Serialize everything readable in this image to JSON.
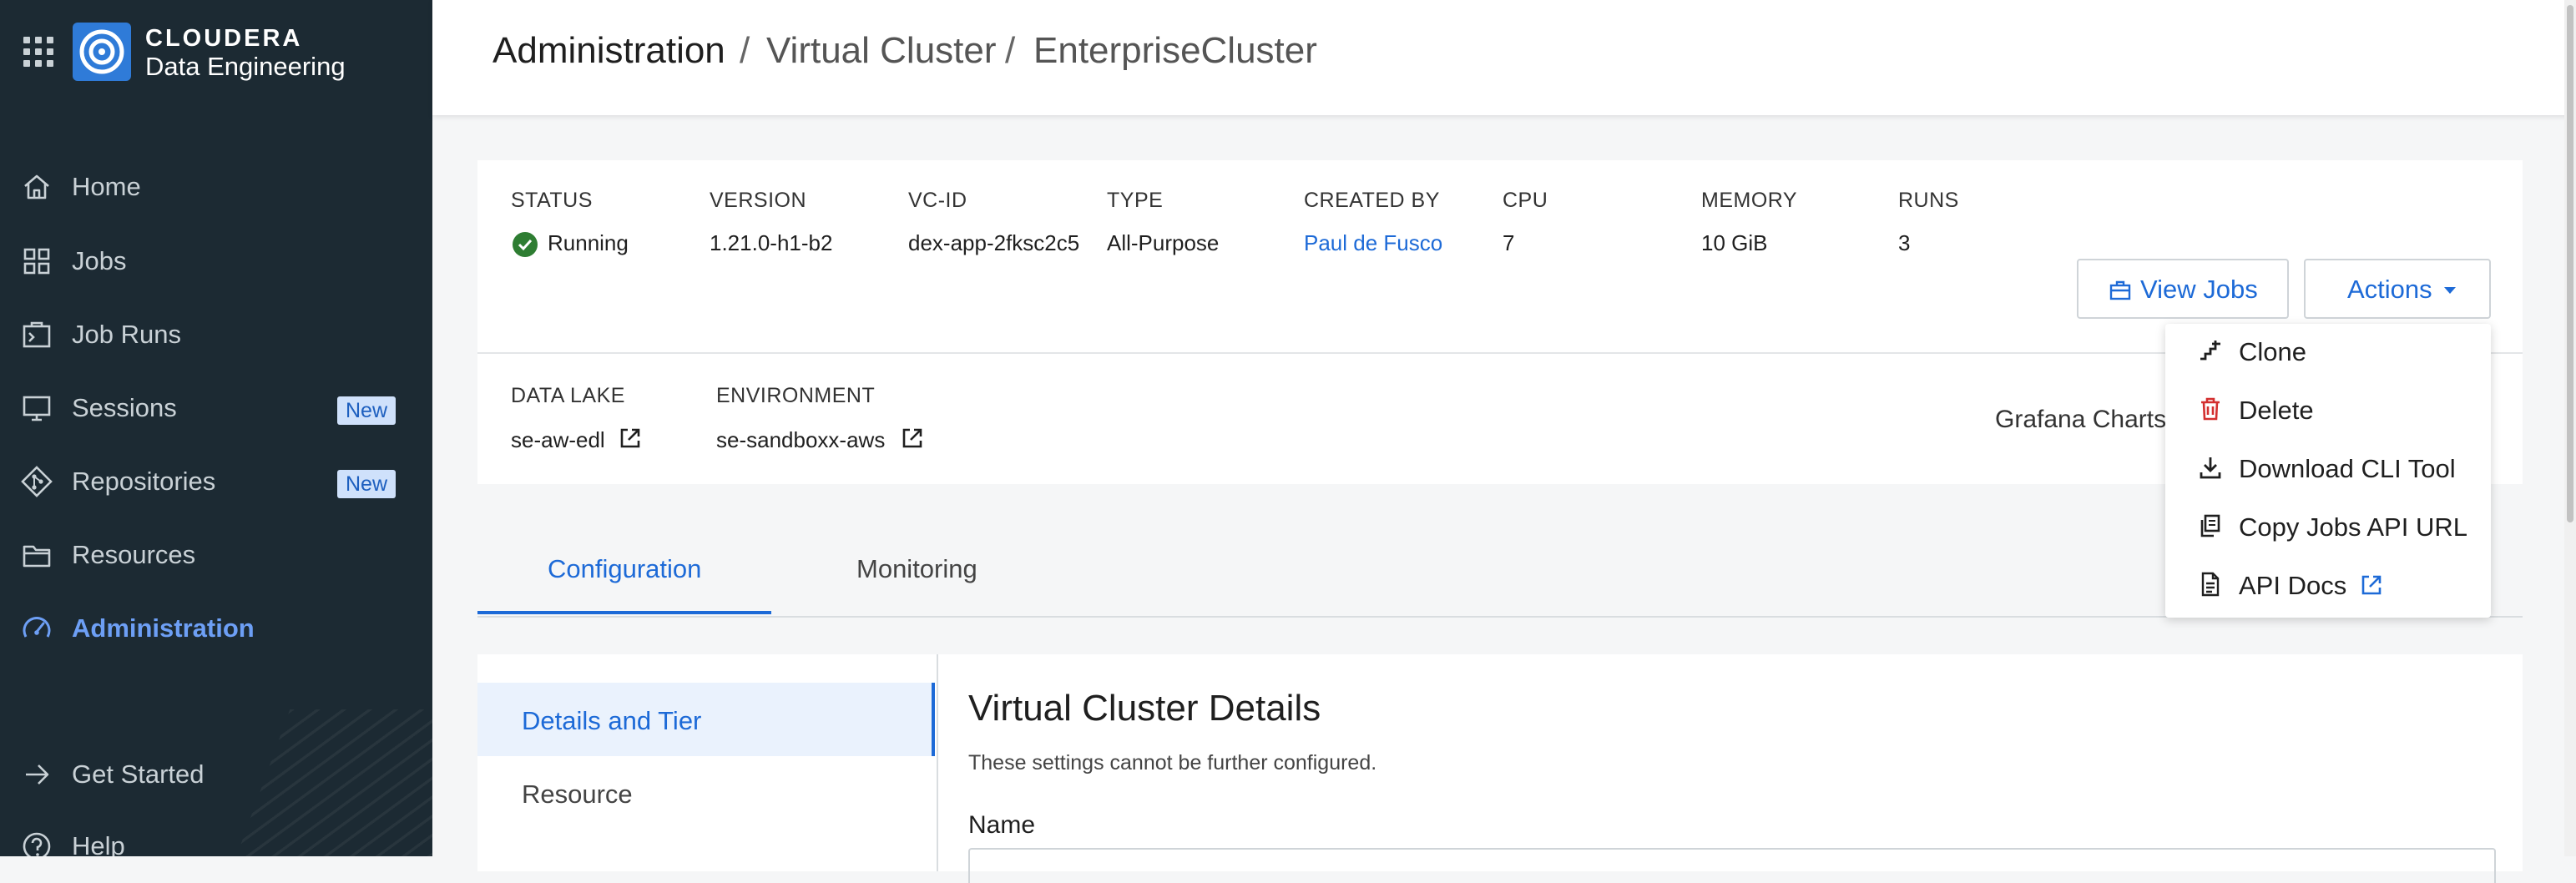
{
  "brand": {
    "name": "CLOUDERA",
    "product": "Data Engineering",
    "accent": "#1d6ad7"
  },
  "sidebar": {
    "items": [
      {
        "label": "Home",
        "icon": "home-icon"
      },
      {
        "label": "Jobs",
        "icon": "grid-icon"
      },
      {
        "label": "Job Runs",
        "icon": "job-runs-icon"
      },
      {
        "label": "Sessions",
        "icon": "monitor-icon",
        "badge": "New"
      },
      {
        "label": "Repositories",
        "icon": "git-icon",
        "badge": "New"
      },
      {
        "label": "Resources",
        "icon": "folder-icon"
      },
      {
        "label": "Administration",
        "icon": "gauge-icon",
        "active": true
      }
    ],
    "footer": [
      {
        "label": "Get Started",
        "icon": "arrow-right-icon"
      },
      {
        "label": "Help",
        "icon": "help-icon"
      }
    ]
  },
  "breadcrumb": [
    "Administration",
    "Virtual Cluster",
    "EnterpriseCluster"
  ],
  "cluster": {
    "fields": [
      {
        "label": "STATUS",
        "value": "Running"
      },
      {
        "label": "VERSION",
        "value": "1.21.0-h1-b2"
      },
      {
        "label": "VC-ID",
        "value": "dex-app-2fksc2c5"
      },
      {
        "label": "TYPE",
        "value": "All-Purpose"
      },
      {
        "label": "CREATED BY",
        "value": "Paul de Fusco"
      },
      {
        "label": "CPU",
        "value": "7"
      },
      {
        "label": "MEMORY",
        "value": "10 GiB"
      },
      {
        "label": "RUNS",
        "value": "3"
      }
    ],
    "links": [
      {
        "label": "DATA LAKE",
        "value": "se-aw-edl"
      },
      {
        "label": "ENVIRONMENT",
        "value": "se-sandboxx-aws"
      }
    ],
    "grafana": "Grafana Charts",
    "status_color": "#2e7d32"
  },
  "buttons": {
    "view_jobs": "View Jobs",
    "actions": "Actions"
  },
  "actions_menu": [
    {
      "label": "Clone",
      "icon": "clone-icon"
    },
    {
      "label": "Delete",
      "icon": "trash-icon"
    },
    {
      "label": "Download CLI Tool",
      "icon": "download-icon"
    },
    {
      "label": "Copy Jobs API URL",
      "icon": "copy-icon"
    },
    {
      "label": "API Docs",
      "icon": "document-icon"
    }
  ],
  "tabs": [
    "Configuration",
    "Monitoring"
  ],
  "config_nav": [
    "Details and Tier",
    "Resource"
  ],
  "details": {
    "title": "Virtual Cluster Details",
    "subtitle": "These settings cannot be further configured.",
    "name_label": "Name"
  }
}
